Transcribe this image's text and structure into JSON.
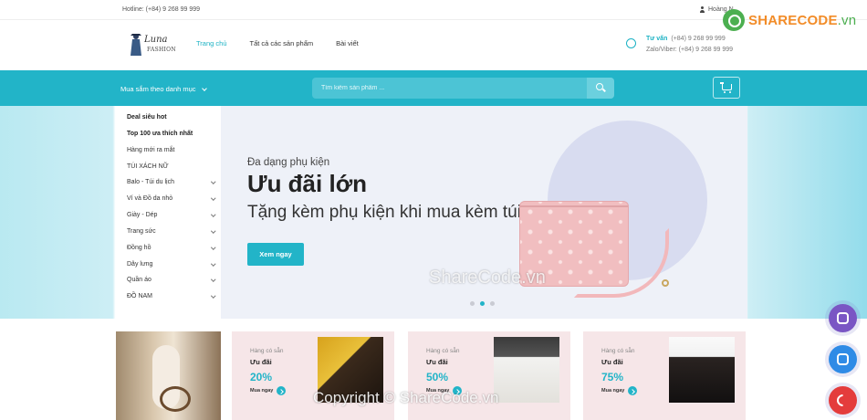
{
  "topbar": {
    "hotline": "Hotline: (+84) 9 268 99 999",
    "user_name": "Hoàng N"
  },
  "brand_watermark": {
    "name": "SHARECODE",
    "tld": ".vn"
  },
  "header": {
    "logo_script": "Luna",
    "logo_word": "FASHION",
    "nav": [
      {
        "label": "Trang chủ",
        "active": true
      },
      {
        "label": "Tất cả các sản phẩm",
        "active": false
      },
      {
        "label": "Bài viết",
        "active": false
      }
    ],
    "consult": {
      "label": "Tư vấn",
      "phone": "(+84) 9 268 99 999",
      "zalo_line": "Zalo/Viber: (+84) 9 268 99 999"
    }
  },
  "searchbar": {
    "category_button": "Mua sắm theo danh mục",
    "placeholder": "Tìm kiếm sản phẩm ..."
  },
  "sidebar": {
    "items": [
      {
        "label": "Deal siêu hot",
        "bold": true,
        "submenu": false
      },
      {
        "label": "Top 100 ưa thích nhất",
        "bold": true,
        "submenu": false
      },
      {
        "label": "Hàng mới ra mắt",
        "bold": false,
        "submenu": false
      },
      {
        "label": "TÚI XÁCH NỮ",
        "bold": false,
        "submenu": false
      },
      {
        "label": "Balo - Túi du lịch",
        "bold": false,
        "submenu": true
      },
      {
        "label": "Ví và Đồ da nhỏ",
        "bold": false,
        "submenu": true
      },
      {
        "label": "Giày - Dép",
        "bold": false,
        "submenu": true
      },
      {
        "label": "Trang sức",
        "bold": false,
        "submenu": true
      },
      {
        "label": "Đồng hồ",
        "bold": false,
        "submenu": true
      },
      {
        "label": "Dây lưng",
        "bold": false,
        "submenu": true
      },
      {
        "label": "Quần áo",
        "bold": false,
        "submenu": true
      },
      {
        "label": "ĐỒ NAM",
        "bold": false,
        "submenu": true
      }
    ]
  },
  "hero": {
    "kicker": "Đa dạng phụ kiện",
    "title": "Ưu đãi lớn",
    "subtitle": "Tặng kèm phụ kiện khi mua kèm túi",
    "button": "Xem ngay",
    "slides_total": 3,
    "active_slide": 2
  },
  "promos": [
    {
      "availability": "Hàng có sẵn",
      "offer": "Ưu đãi",
      "discount": "20%",
      "cta": "Mua ngay"
    },
    {
      "availability": "Hàng có sẵn",
      "offer": "Ưu đãi",
      "discount": "50%",
      "cta": "Mua ngay"
    },
    {
      "availability": "Hàng có sẵn",
      "offer": "Ưu đãi",
      "discount": "75%",
      "cta": "Mua ngay"
    }
  ],
  "watermarks": {
    "center": "ShareCode.vn",
    "bottom": "Copyright © ShareCode.vn"
  },
  "colors": {
    "accent": "#22b4c8",
    "promo_bg": "#f6e6e8",
    "hero_bg": "#eef1f8",
    "brand_orange": "#f28c28",
    "brand_green": "#4caf50"
  },
  "floating_actions": [
    "viber-icon",
    "zalo-icon",
    "phone-icon"
  ]
}
